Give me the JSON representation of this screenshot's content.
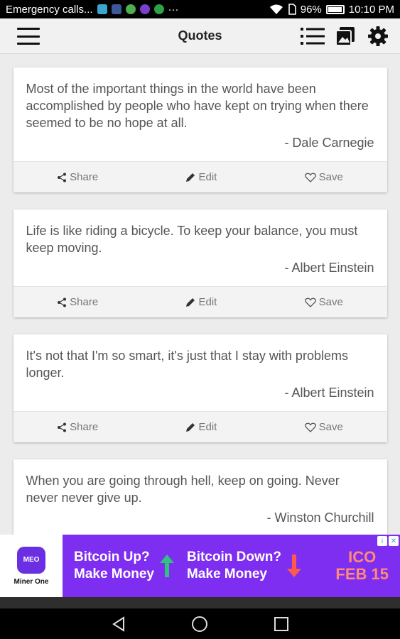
{
  "status_bar": {
    "notification_text": "Emergency calls...",
    "battery_text": "96%",
    "time": "10:10 PM",
    "notification_icons": [
      {
        "name": "app-icon-1",
        "color": "#3aa6d0"
      },
      {
        "name": "facebook-icon",
        "color": "#3b5998"
      },
      {
        "name": "app-icon-3",
        "color": "#4caf50"
      },
      {
        "name": "app-icon-4",
        "color": "#7b3fd0"
      },
      {
        "name": "app-icon-5",
        "color": "#2e9f4a"
      }
    ],
    "more_indicator": "···"
  },
  "app_bar": {
    "title": "Quotes"
  },
  "cards": [
    {
      "quote": "Most of the important things in the world have been accomplished by people who have kept on trying when there seemed to be no hope at all.",
      "author": "- Dale Carnegie"
    },
    {
      "quote": "Life is like riding a bicycle. To keep your balance, you must keep moving.",
      "author": "- Albert Einstein"
    },
    {
      "quote": "It's not that I'm so smart, it's just that I stay with problems longer.",
      "author": "- Albert Einstein"
    },
    {
      "quote": "When you are going through hell, keep on going. Never never never give up.",
      "author": "- Winston Churchill"
    }
  ],
  "card_actions": {
    "share": "Share",
    "edit": "Edit",
    "save": "Save"
  },
  "ad": {
    "logo_badge": "MEO",
    "logo_text": "Miner One",
    "up_line1": "Bitcoin Up?",
    "up_line2": "Make Money",
    "down_line1": "Bitcoin Down?",
    "down_line2": "Make Money",
    "ico_line1": "ICO",
    "ico_line2": "FEB 15",
    "brand_color": "#7e2ef0",
    "up_color": "#2ec27e",
    "down_color": "#ff5a4a"
  }
}
